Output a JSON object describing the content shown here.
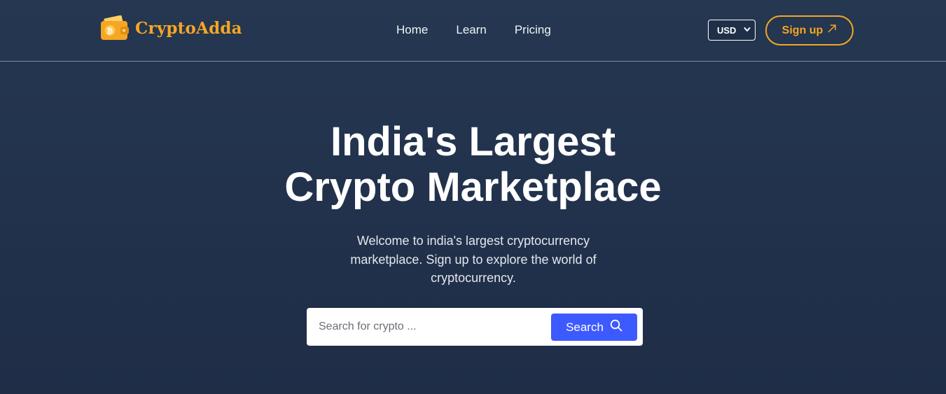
{
  "brand": {
    "name": "CryptoAdda",
    "icon": "bitcoin-wallet-icon",
    "color": "#f5a623"
  },
  "nav": {
    "links": [
      "Home",
      "Learn",
      "Pricing"
    ]
  },
  "currency": {
    "selected": "USD",
    "icon": "chevron-down-icon"
  },
  "signup": {
    "label": "Sign up",
    "icon": "arrow-up-right-icon"
  },
  "hero": {
    "title_line1": "India's Largest",
    "title_line2": "Crypto Marketplace",
    "subtitle": "Welcome to india's largest cryptocurrency marketplace. Sign up to explore the world of cryptocurrency."
  },
  "search": {
    "placeholder": "Search for crypto ...",
    "value": "",
    "button_label": "Search",
    "icon": "search-icon",
    "accent": "#3d5afe"
  }
}
